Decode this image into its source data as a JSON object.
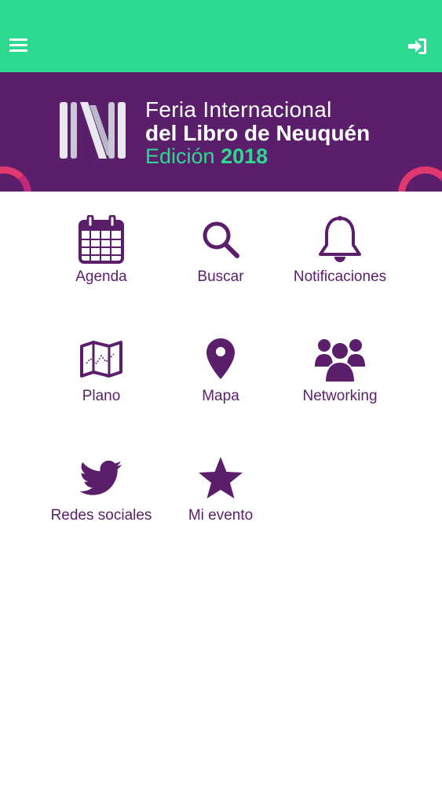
{
  "colors": {
    "topbar": "#2dd98f",
    "banner": "#5a1e6b",
    "accent_purple": "#5a1e6b",
    "accent_green": "#2dd98f",
    "ring": "#e0386f"
  },
  "header": {
    "menu_icon": "hamburger-menu-icon",
    "login_icon": "sign-in-icon"
  },
  "banner": {
    "title_line1": "Feria Internacional",
    "title_line2": "del Libro de Neuquén",
    "edition_word": "Edición",
    "edition_year": "2018"
  },
  "menu": {
    "items": [
      {
        "label": "Agenda",
        "icon": "calendar-icon"
      },
      {
        "label": "Buscar",
        "icon": "search-icon"
      },
      {
        "label": "Notificaciones",
        "icon": "bell-icon"
      },
      {
        "label": "Plano",
        "icon": "map-plan-icon"
      },
      {
        "label": "Mapa",
        "icon": "map-marker-icon"
      },
      {
        "label": "Networking",
        "icon": "users-icon"
      },
      {
        "label": "Redes sociales",
        "icon": "twitter-icon"
      },
      {
        "label": "Mi evento",
        "icon": "star-icon"
      }
    ]
  }
}
